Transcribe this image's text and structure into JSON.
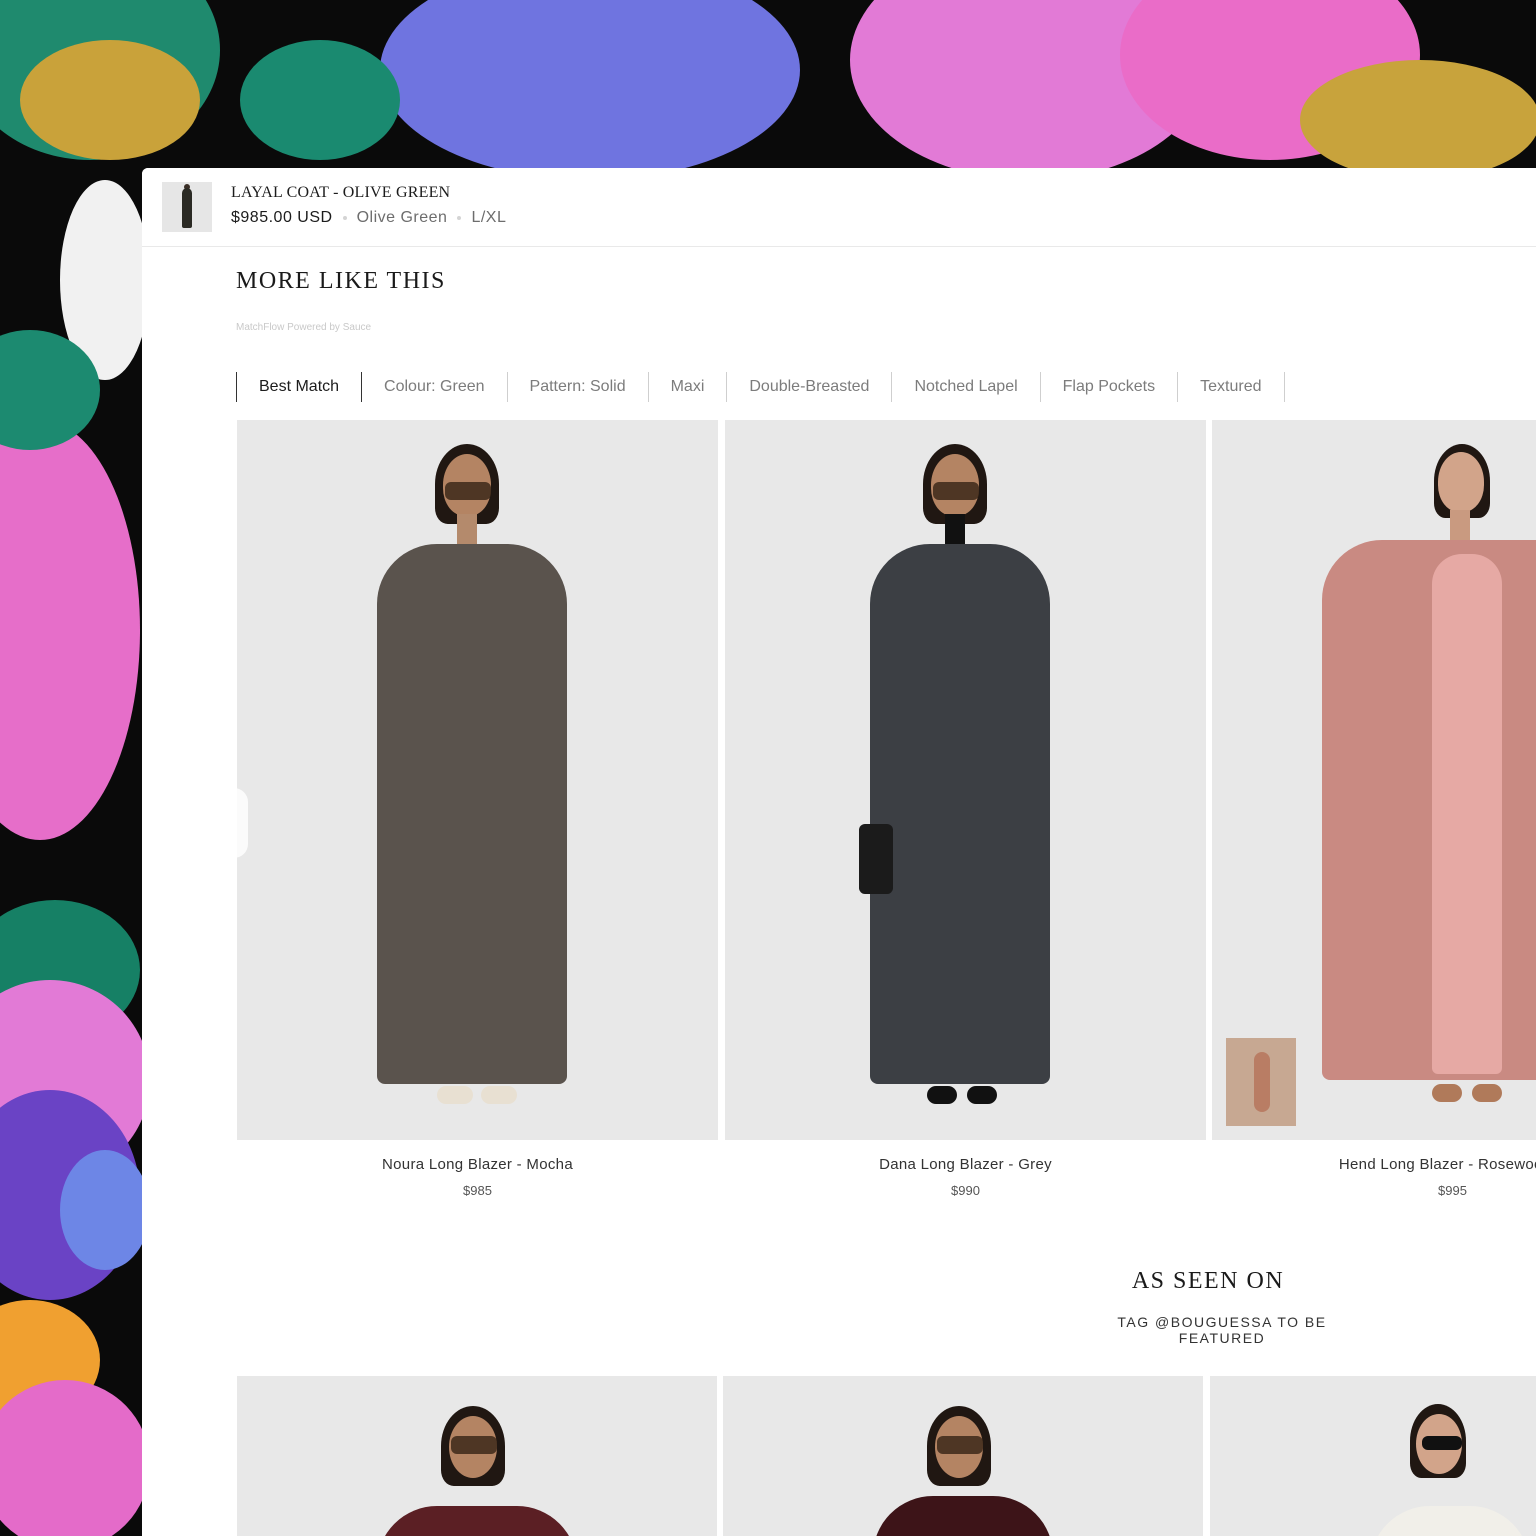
{
  "sticky_product": {
    "title": "LAYAL COAT - OLIVE GREEN",
    "price": "$985.00 USD",
    "color": "Olive Green",
    "size": "L/XL"
  },
  "section": {
    "title": "MORE LIKE THIS",
    "powered_by": "MatchFlow Powered by Sauce"
  },
  "filters": [
    "Best Match",
    "Colour: Green",
    "Pattern: Solid",
    "Maxi",
    "Double-Breasted",
    "Notched Lapel",
    "Flap Pockets",
    "Textured"
  ],
  "products": [
    {
      "name": "Noura Long Blazer - Mocha",
      "price": "$985",
      "coat": "#5a534d"
    },
    {
      "name": "Dana Long Blazer - Grey",
      "price": "$990",
      "coat": "#3c3f44"
    },
    {
      "name": "Hend Long Blazer - Rosewood &",
      "price": "$995",
      "coat": "#c98a82"
    }
  ],
  "as_seen_on": {
    "title": "AS SEEN ON",
    "subtitle": "TAG @BOUGUESSA TO BE FEATURED"
  },
  "colors": {
    "panel": "#ffffff",
    "card_bg": "#e8e8e8",
    "text_dark": "#1c1c1c",
    "text_muted": "#7c7c7c"
  }
}
